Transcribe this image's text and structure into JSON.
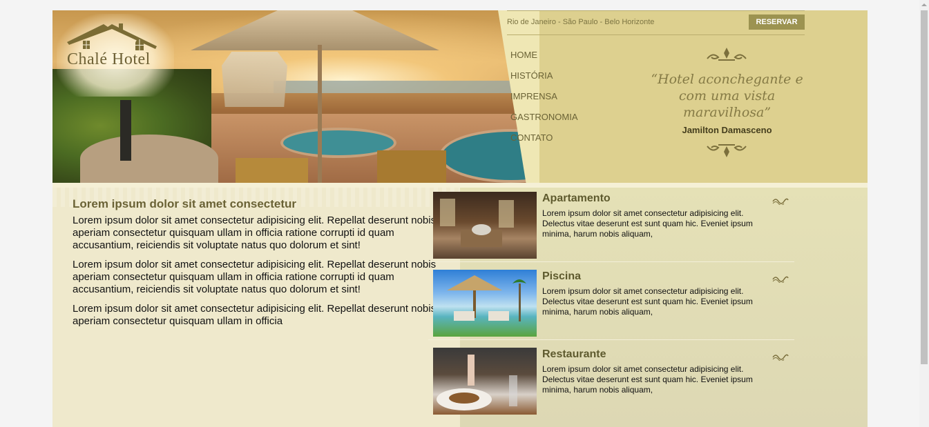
{
  "brand": {
    "name": "Chalé Hotel"
  },
  "header": {
    "locations": "Rio de Janeiro - São Paulo - Belo Horizonte",
    "reserve_label": "RESERVAR",
    "nav": [
      "HOME",
      "HISTÓRIA",
      "IMPRENSA",
      "GASTRONOMIA",
      "CONTATO"
    ],
    "quote": "“Hotel aconchegante e com uma vista maravilhosa”",
    "quote_author": "Jamilton Damasceno"
  },
  "article": {
    "title": "Lorem ipsum dolor sit amet consectetur",
    "paragraphs": [
      "Lorem ipsum dolor sit amet consectetur adipisicing elit. Repellat deserunt nobis aperiam consectetur quisquam ullam in officia ratione corrupti id quam accusantium, reiciendis sit voluptate natus quo dolorum et sint!",
      "Lorem ipsum dolor sit amet consectetur adipisicing elit. Repellat deserunt nobis aperiam consectetur quisquam ullam in officia ratione corrupti id quam accusantium, reiciendis sit voluptate natus quo dolorum et sint!",
      "Lorem ipsum dolor sit amet consectetur adipisicing elit. Repellat deserunt nobis aperiam consectetur quisquam ullam in officia"
    ]
  },
  "cards": [
    {
      "title": "Apartamento",
      "text": "Lorem ipsum dolor sit amet consectetur adipisicing elit. Delectus vitae deserunt est sunt quam hic. Eveniet ipsum minima, harum nobis aliquam,"
    },
    {
      "title": "Piscina",
      "text": "Lorem ipsum dolor sit amet consectetur adipisicing elit. Delectus vitae deserunt est sunt quam hic. Eveniet ipsum minima, harum nobis aliquam,"
    },
    {
      "title": "Restaurante",
      "text": "Lorem ipsum dolor sit amet consectetur adipisicing elit. Delectus vitae deserunt est sunt quam hic. Eveniet ipsum minima, harum nobis aliquam,"
    }
  ],
  "colors": {
    "accent": "#9c9351",
    "header_bg": "#ddd08f",
    "panel_bg": "#efe9cc",
    "title_text": "#6a6235"
  }
}
